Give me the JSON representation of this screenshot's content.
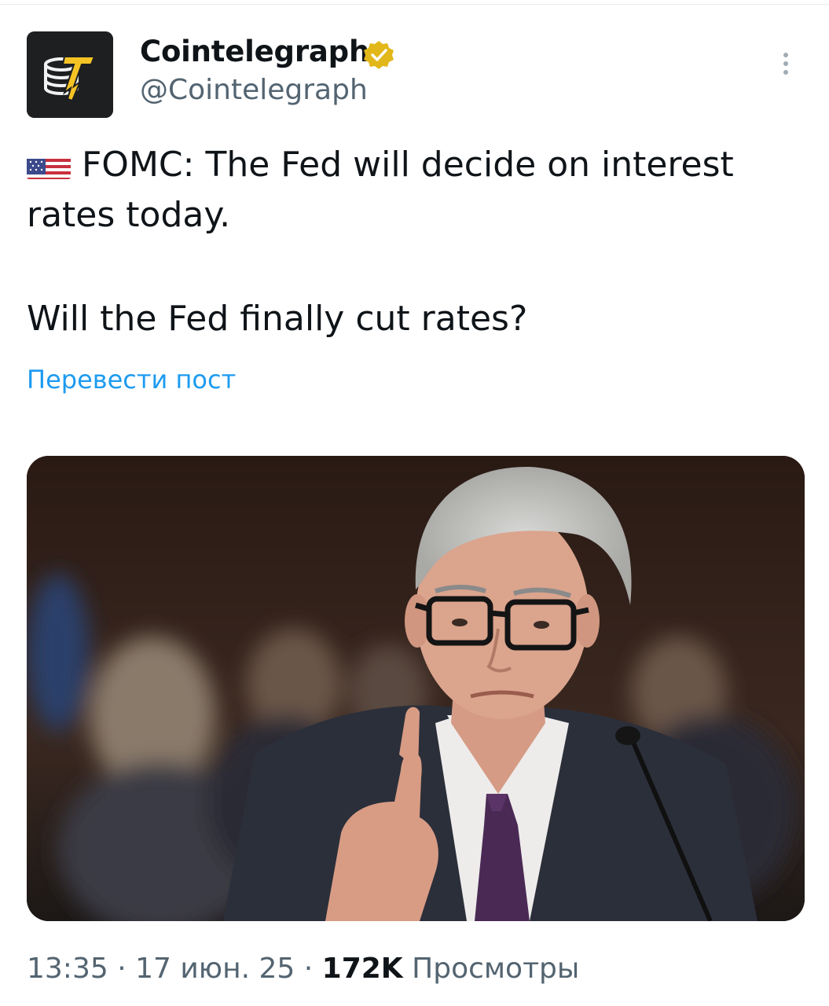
{
  "author": {
    "name": "Cointelegraph",
    "handle": "@Cointelegraph"
  },
  "tweet": {
    "flag_icon": "us-flag-icon",
    "line1": "FOMC: The Fed will decide on interest rates today.",
    "line2": "Will the Fed finally cut rates?"
  },
  "translate_label": "Перевести пост",
  "meta": {
    "time": "13:35",
    "separator": "·",
    "date": "17 июн. 25",
    "views_count": "172K",
    "views_label": "Просмотры"
  },
  "colors": {
    "link": "#1d9bf0",
    "secondary_text": "#536471",
    "verified_badge": "#e2b719"
  }
}
